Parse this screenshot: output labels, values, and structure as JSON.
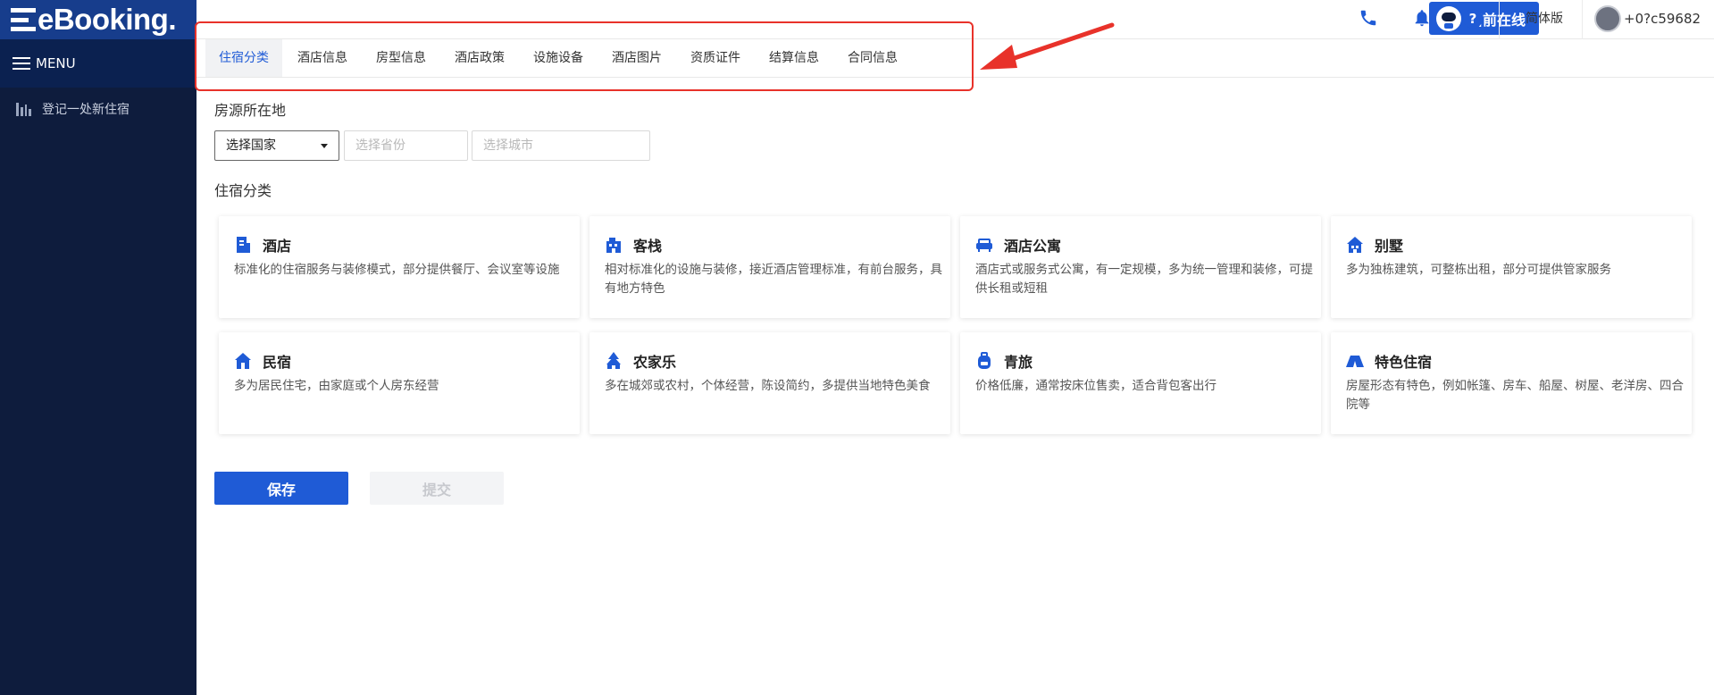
{
  "logo": {
    "text": "eBooking."
  },
  "sidebar": {
    "menu_label": "MENU",
    "items": [
      {
        "label": "登记一处新住宿",
        "icon": "building-icon"
      }
    ]
  },
  "header": {
    "online_label": "当前在线",
    "version_label": "简体版",
    "user_id": "+0?c59682"
  },
  "tabs": [
    {
      "label": "住宿分类",
      "active": true
    },
    {
      "label": "酒店信息"
    },
    {
      "label": "房型信息"
    },
    {
      "label": "酒店政策"
    },
    {
      "label": "设施设备"
    },
    {
      "label": "酒店图片"
    },
    {
      "label": "资质证件"
    },
    {
      "label": "结算信息"
    },
    {
      "label": "合同信息"
    }
  ],
  "location": {
    "title": "房源所在地",
    "country_value": "选择国家",
    "province_placeholder": "选择省份",
    "city_placeholder": "选择城市"
  },
  "category": {
    "title": "住宿分类",
    "cards": [
      {
        "title": "酒店",
        "desc": "标准化的住宿服务与装修模式，部分提供餐厅、会议室等设施",
        "icon": "hotel-icon"
      },
      {
        "title": "客栈",
        "desc": "相对标准化的设施与装修，接近酒店管理标准，有前台服务，具有地方特色",
        "icon": "inn-icon"
      },
      {
        "title": "酒店公寓",
        "desc": "酒店式或服务式公寓，有一定规模，多为统一管理和装修，可提供长租或短租",
        "icon": "sofa-icon"
      },
      {
        "title": "别墅",
        "desc": "多为独栋建筑，可整栋出租，部分可提供管家服务",
        "icon": "villa-icon"
      },
      {
        "title": "民宿",
        "desc": "多为居民住宅，由家庭或个人房东经营",
        "icon": "house-icon"
      },
      {
        "title": "农家乐",
        "desc": "多在城郊或农村，个体经营，陈设简约，多提供当地特色美食",
        "icon": "farmhouse-icon"
      },
      {
        "title": "青旅",
        "desc": "价格低廉，通常按床位售卖，适合背包客出行",
        "icon": "backpack-icon"
      },
      {
        "title": "特色住宿",
        "desc": "房屋形态有特色，例如帐篷、房车、船屋、树屋、老洋房、四合院等",
        "icon": "tent-icon"
      }
    ]
  },
  "actions": {
    "save_label": "保存",
    "submit_label": "提交"
  },
  "colors": {
    "primary": "#1f5bd6",
    "sidebar": "#0e1c3d",
    "highlight": "#e8322a"
  }
}
